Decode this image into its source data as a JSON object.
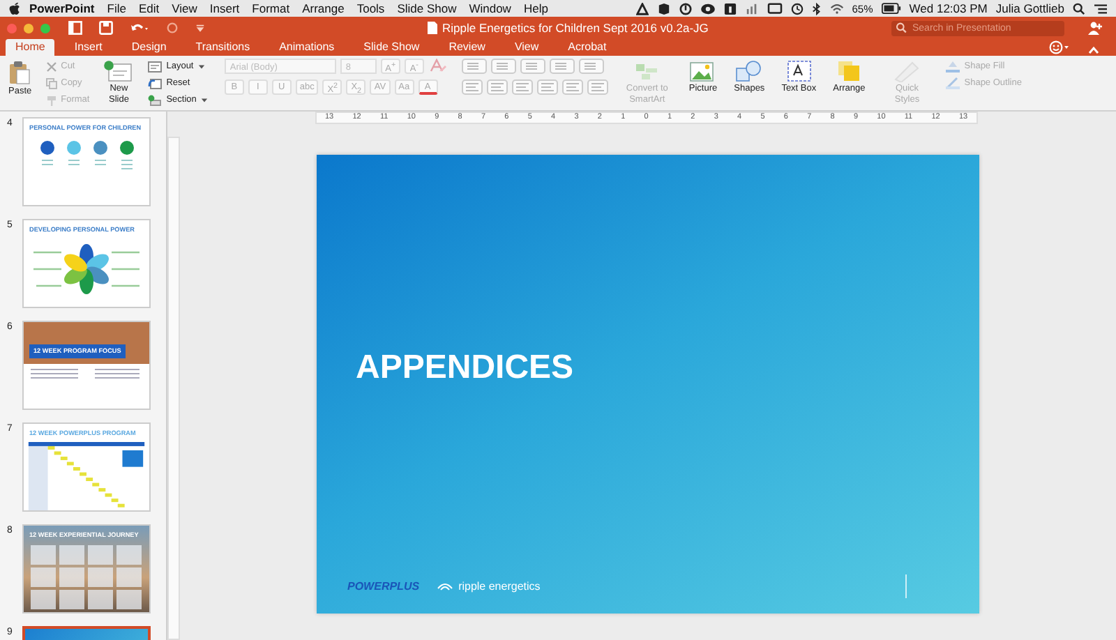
{
  "menu_bar": {
    "app": "PowerPoint",
    "menus": [
      "File",
      "Edit",
      "View",
      "Insert",
      "Format",
      "Arrange",
      "Tools",
      "Slide Show",
      "Window",
      "Help"
    ],
    "battery": "65%",
    "clock": "Wed 12:03 PM",
    "user": "Julia Gottlieb"
  },
  "window": {
    "title": "Ripple Energetics for Children Sept 2016 v0.2a-JG",
    "search": {
      "placeholder": "Search in Presentation"
    }
  },
  "tabs": [
    {
      "label": "Home",
      "selected": true
    },
    {
      "label": "Insert",
      "selected": false
    },
    {
      "label": "Design",
      "selected": false
    },
    {
      "label": "Transitions",
      "selected": false
    },
    {
      "label": "Animations",
      "selected": false
    },
    {
      "label": "Slide Show",
      "selected": false
    },
    {
      "label": "Review",
      "selected": false
    },
    {
      "label": "View",
      "selected": false
    },
    {
      "label": "Acrobat",
      "selected": false
    }
  ],
  "ribbon": {
    "paste": "Paste",
    "clipboard": [
      {
        "label": "Cut",
        "kind": "cut",
        "disabled": true
      },
      {
        "label": "Copy",
        "kind": "copy",
        "disabled": true
      },
      {
        "label": "Format",
        "kind": "format",
        "disabled": true
      }
    ],
    "new_slide": "New Slide",
    "slide_tools": [
      {
        "label": "Layout",
        "kind": "layout"
      },
      {
        "label": "Reset",
        "kind": "reset"
      },
      {
        "label": "Section",
        "kind": "section"
      }
    ],
    "font_name": "Arial (Body)",
    "font_size": "8",
    "size_buttons": [
      "A$^{+}$",
      "A$^{-}$"
    ],
    "font_buttons": [
      "B",
      "I",
      "U",
      "abc",
      "X$^{2}$",
      "X$_{2}$",
      "AV",
      "Aa"
    ],
    "font_color": "A",
    "tools": [
      {
        "label": "Convert to SmartArt",
        "kind": "smartart",
        "disabled": true
      },
      {
        "label": "Picture",
        "kind": "picture",
        "disabled": false
      },
      {
        "label": "Shapes",
        "kind": "shapes",
        "disabled": false
      },
      {
        "label": "Text Box",
        "kind": "textbox",
        "disabled": false
      },
      {
        "label": "Arrange",
        "kind": "arrange",
        "disabled": false
      },
      {
        "label": "Quick Styles",
        "kind": "styles",
        "disabled": true
      }
    ],
    "shape_format": [
      {
        "label": "Shape Fill",
        "kind": "fill",
        "disabled": true
      },
      {
        "label": "Shape Outline",
        "kind": "outline",
        "disabled": true
      }
    ]
  },
  "ruler": {
    "labels": [
      "13",
      "12",
      "11",
      "10",
      "9",
      "8",
      "7",
      "6",
      "5",
      "4",
      "3",
      "2",
      "1",
      "0",
      "1",
      "2",
      "3",
      "4",
      "5",
      "6",
      "7",
      "8",
      "9",
      "10",
      "11",
      "12",
      "13"
    ]
  },
  "thumbnails": [
    {
      "number": "4",
      "kind": "circles",
      "title": "PERSONAL POWER FOR CHILDREN",
      "selected": false
    },
    {
      "number": "5",
      "kind": "flower",
      "title": "DEVELOPING **PERSONAL POWER**",
      "selected": false
    },
    {
      "number": "6",
      "kind": "photo",
      "title": "12 WEEK PROGRAM FOCUS",
      "selected": false
    },
    {
      "number": "7",
      "kind": "gantt",
      "title": "12 WEEK **POWERPLUS PROGRAM**",
      "selected": false
    },
    {
      "number": "8",
      "kind": "journey",
      "title": "12 WEEK **EXPERIENTIAL JOURNEY**",
      "selected": false
    },
    {
      "number": "9",
      "kind": "blank",
      "selected": true
    }
  ],
  "slide": {
    "title": "APPENDICES",
    "brand": "POWERPLUS",
    "company": "ripple energetics"
  }
}
